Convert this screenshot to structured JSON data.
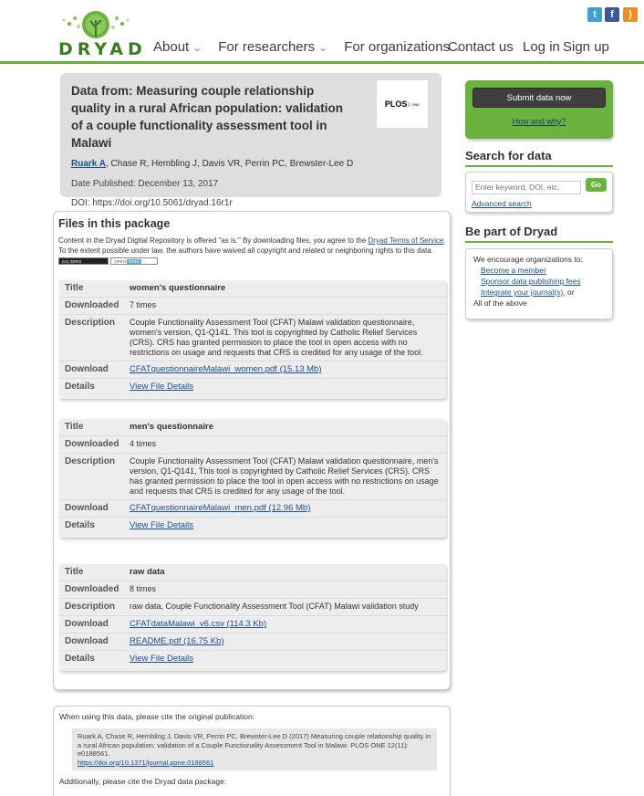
{
  "header": {
    "logo_text": "DRYAD",
    "nav": [
      {
        "label": "About"
      },
      {
        "label": "For researchers"
      },
      {
        "label": "For organizations"
      }
    ],
    "contact": "Contact us",
    "login": "Log in",
    "signup": "Sign up",
    "social": [
      {
        "icon": "twitter-icon",
        "glyph": "t"
      },
      {
        "icon": "facebook-icon",
        "glyph": "f"
      },
      {
        "icon": "rss-icon",
        "glyph": ")"
      }
    ],
    "nav_caret": "⌄"
  },
  "record": {
    "title": "Data from: Measuring couple relationship quality in a rural African population: validation of a couple functionality assessment tool in Malawi",
    "first_author": "Ruark A",
    "authors_rest": ", Chase R, Hembling J, Davis VR, Perrin PC, Brewster-Lee D",
    "date_published": "Date Published: December 13, 2017",
    "doi": "DOI: https://doi.org/10.5061/dryad.16r1r",
    "journal_logo_text": "PLOS",
    "journal_logo_sub": "ONE"
  },
  "files": {
    "heading": "Files in this package",
    "intro_1": "Content in the Dryad Digital Repository is offered \"as is.\" By downloading files, you agree to the ",
    "intro_link": "Dryad Terms of Service",
    "intro_2": ". To the extent possible under law, the authors have waived all copyright and related or neighboring rights to this data.",
    "badge_cc": "(cc) ZERO",
    "badge_open": "OPEN",
    "badge_data": "DATA",
    "labels": {
      "title": "Title",
      "downloaded": "Downloaded",
      "description": "Description",
      "download": "Download",
      "details": "Details"
    },
    "items": [
      {
        "title": "women's questionnaire",
        "downloaded": "7 times",
        "description": "Couple Functionality Assessment Tool (CFAT) Malawi validation questionnaire, women's version, Q1-Q141. This tool is copyrighted by Catholic Relief Services (CRS). CRS has granted permission to place the tool in open access with no restrictions on usage and requests that CRS is credited for any usage of the tool.",
        "downloads": [
          "CFATquestionnaireMalawi_women.pdf (15.13 Mb)"
        ],
        "details": "View File Details"
      },
      {
        "title": "men's questionnaire",
        "downloaded": "4 times",
        "description": "Couple Functionality Assessment Tool (CFAT) Malawi validation questionnaire, men's version, Q1-Q141, This tool is copyrighted by Catholic Relief Services (CRS). CRS has granted permission to place the tool in open access with no restrictions on usage and requests that CRS is credited for any usage of the tool.",
        "downloads": [
          "CFATquestionnaireMalawi_men.pdf (12.96 Mb)"
        ],
        "details": "View File Details"
      },
      {
        "title": "raw data",
        "downloaded": "8 times",
        "description": "raw data, Couple Functionality Assessment Tool (CFAT) Malawi validation study",
        "downloads": [
          "CFATdataMalawi_v6.csv (114.3 Kb)",
          "README.pdf (16.75 Kb)"
        ],
        "details": "View File Details"
      }
    ]
  },
  "citation": {
    "intro": "When using this data, please cite the original publication:",
    "text": "Ruark A, Chase R, Hembling J, Davis VR, Perrin PC, Brewster-Lee D (2017) Measuring couple relationship quality in a rural African population: validation of a Couple Functionality Assessment Tool in Malawi. PLOS ONE 12(11): e0188561.",
    "link": "https://doi.org/10.1371/journal.pone.0188561",
    "additional": "Additionally, please cite the Dryad data package:"
  },
  "sidebar": {
    "submit_label": "Submit data now",
    "how_why": "How and why?",
    "search_heading": "Search for data",
    "search_placeholder": "Enter keyword, DOI, etc.",
    "go_label": "Go",
    "advanced_search": "Advanced search",
    "part_heading": "Be part of Dryad",
    "part_intro": "We encourage organizations to:",
    "part_links": [
      "Become a member",
      "Sponsor data publishing fees",
      "Integrate your journal(s)"
    ],
    "part_or": ", or",
    "part_last": "All of the above"
  },
  "colors": {
    "brand_green": "#6ab33e",
    "link_blue": "#1a4f8e"
  }
}
